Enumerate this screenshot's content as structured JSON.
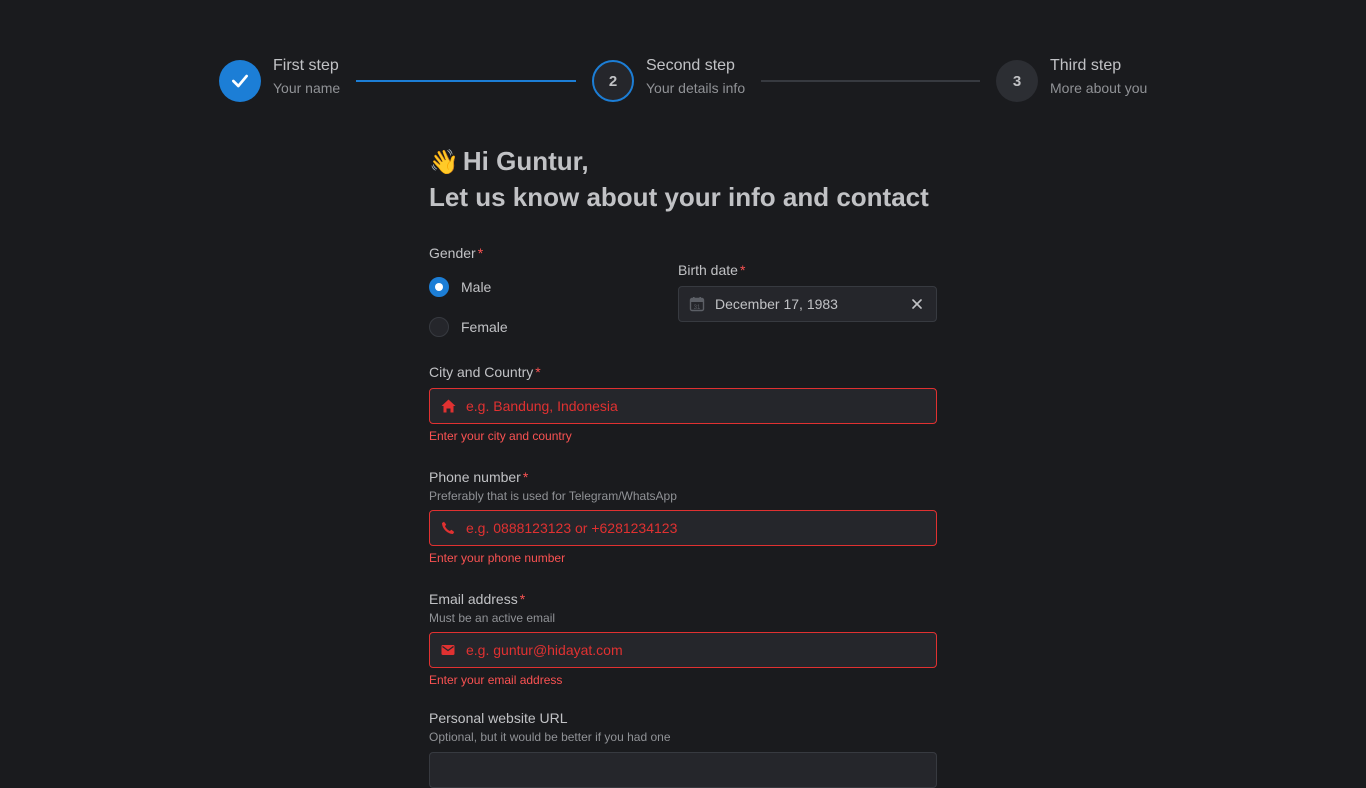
{
  "stepper": {
    "steps": [
      {
        "title": "First step",
        "description": "Your name",
        "status": "completed"
      },
      {
        "title": "Second step",
        "description": "Your details info",
        "status": "active",
        "number": "2"
      },
      {
        "title": "Third step",
        "description": "More about you",
        "status": "pending",
        "number": "3"
      }
    ]
  },
  "greeting": {
    "emoji": "👋",
    "line1": "Hi Guntur,",
    "line2": "Let us know about your info and contact"
  },
  "gender": {
    "label": "Gender",
    "required_mark": "*",
    "options": [
      {
        "label": "Male",
        "checked": true
      },
      {
        "label": "Female",
        "checked": false
      }
    ]
  },
  "birth_date": {
    "label": "Birth date",
    "required_mark": "*",
    "value": "December 17, 1983"
  },
  "city": {
    "label": "City and Country",
    "required_mark": "*",
    "placeholder": "e.g. Bandung, Indonesia",
    "error": "Enter your city and country"
  },
  "phone": {
    "label": "Phone number",
    "required_mark": "*",
    "description": "Preferably that is used for Telegram/WhatsApp",
    "placeholder": "e.g. 0888123123 or +6281234123",
    "error": "Enter your phone number"
  },
  "email": {
    "label": "Email address",
    "required_mark": "*",
    "description": "Must be an active email",
    "placeholder": "e.g. guntur@hidayat.com",
    "error": "Enter your email address"
  },
  "website": {
    "label": "Personal website URL",
    "description": "Optional, but it would be better if you had one"
  },
  "colors": {
    "accent": "#1c7ed6",
    "error": "#fa5252",
    "background": "#1a1b1e"
  }
}
